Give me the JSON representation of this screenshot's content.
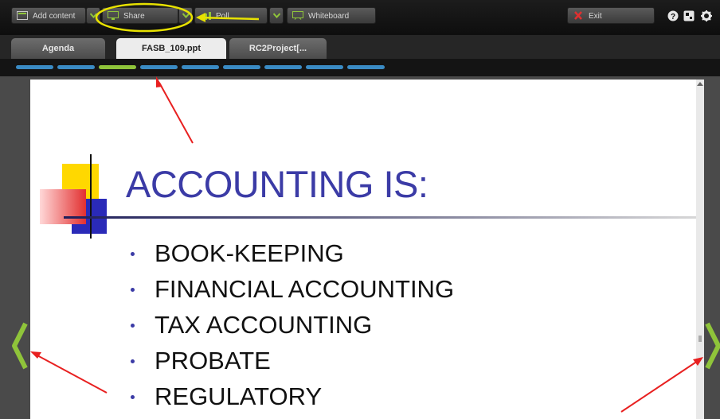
{
  "toolbar": {
    "add_content_label": "Add content",
    "share_label": "Share",
    "poll_label": "Poll",
    "whiteboard_label": "Whiteboard",
    "exit_label": "Exit"
  },
  "tabs": [
    {
      "label": "Agenda",
      "active": false
    },
    {
      "label": "FASB_109.ppt",
      "active": true
    },
    {
      "label": "RC2Project[...",
      "active": false
    }
  ],
  "slide_progress": {
    "total": 9,
    "current": 3
  },
  "slide": {
    "title": "ACCOUNTING IS:",
    "bullets": [
      "BOOK-KEEPING",
      "FINANCIAL ACCOUNTING",
      "TAX ACCOUNTING",
      "PROBATE",
      "REGULATORY"
    ]
  },
  "icons": [
    "help-icon",
    "fullscreen-icon",
    "settings-icon",
    "add-content-icon",
    "share-icon",
    "whiteboard-icon",
    "exit-icon",
    "prev-slide-icon",
    "next-slide-icon"
  ],
  "colors": {
    "accent_green": "#8fc43a",
    "progress_blue": "#3a8bc4",
    "title_blue": "#3b3ba6",
    "annotation_yellow": "#e8e200",
    "annotation_red": "#e82020"
  }
}
